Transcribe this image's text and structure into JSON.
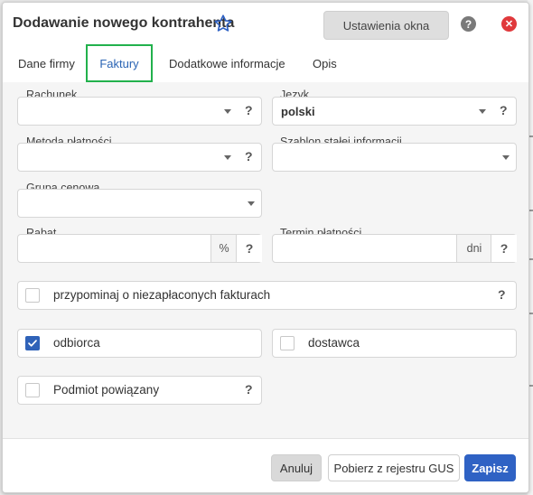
{
  "dialog": {
    "title": "Dodawanie nowego kontrahenta",
    "settings_button": "Ustawienia okna",
    "help_symbol": "?",
    "close_symbol": "✕"
  },
  "tabs": [
    {
      "label": "Dane firmy",
      "active": false
    },
    {
      "label": "Faktury",
      "active": true
    },
    {
      "label": "Dodatkowe informacje",
      "active": false
    },
    {
      "label": "Opis",
      "active": false
    }
  ],
  "form": {
    "rachunek": {
      "label": "Rachunek",
      "value": ""
    },
    "jezyk": {
      "label": "Język",
      "value": "polski"
    },
    "metoda_platnosci": {
      "label": "Metoda płatności",
      "value": ""
    },
    "szablon": {
      "label": "Szablon stałej informacji",
      "value": ""
    },
    "grupa_cenowa": {
      "label": "Grupa cenowa",
      "value": ""
    },
    "rabat": {
      "label": "Rabat",
      "value": "",
      "unit": "%"
    },
    "termin_platnosci": {
      "label": "Termin płatności",
      "value": "",
      "unit": "dni"
    },
    "help_symbol": "?",
    "checkboxes": {
      "przypominaj": {
        "label": "przypominaj o niezapłaconych fakturach",
        "checked": false
      },
      "odbiorca": {
        "label": "odbiorca",
        "checked": true
      },
      "dostawca": {
        "label": "dostawca",
        "checked": false
      },
      "podmiot": {
        "label": "Podmiot powiązany",
        "checked": false
      }
    }
  },
  "footer": {
    "cancel": "Anuluj",
    "gus": "Pobierz z rejestru GUS",
    "save": "Zapisz"
  },
  "colors": {
    "accent": "#2f62c4",
    "active_tab_border": "#22b14c",
    "close": "#e0393c"
  },
  "icons": [
    "star-icon",
    "help-icon",
    "close-icon",
    "dropdown-caret-icon",
    "check-icon"
  ]
}
